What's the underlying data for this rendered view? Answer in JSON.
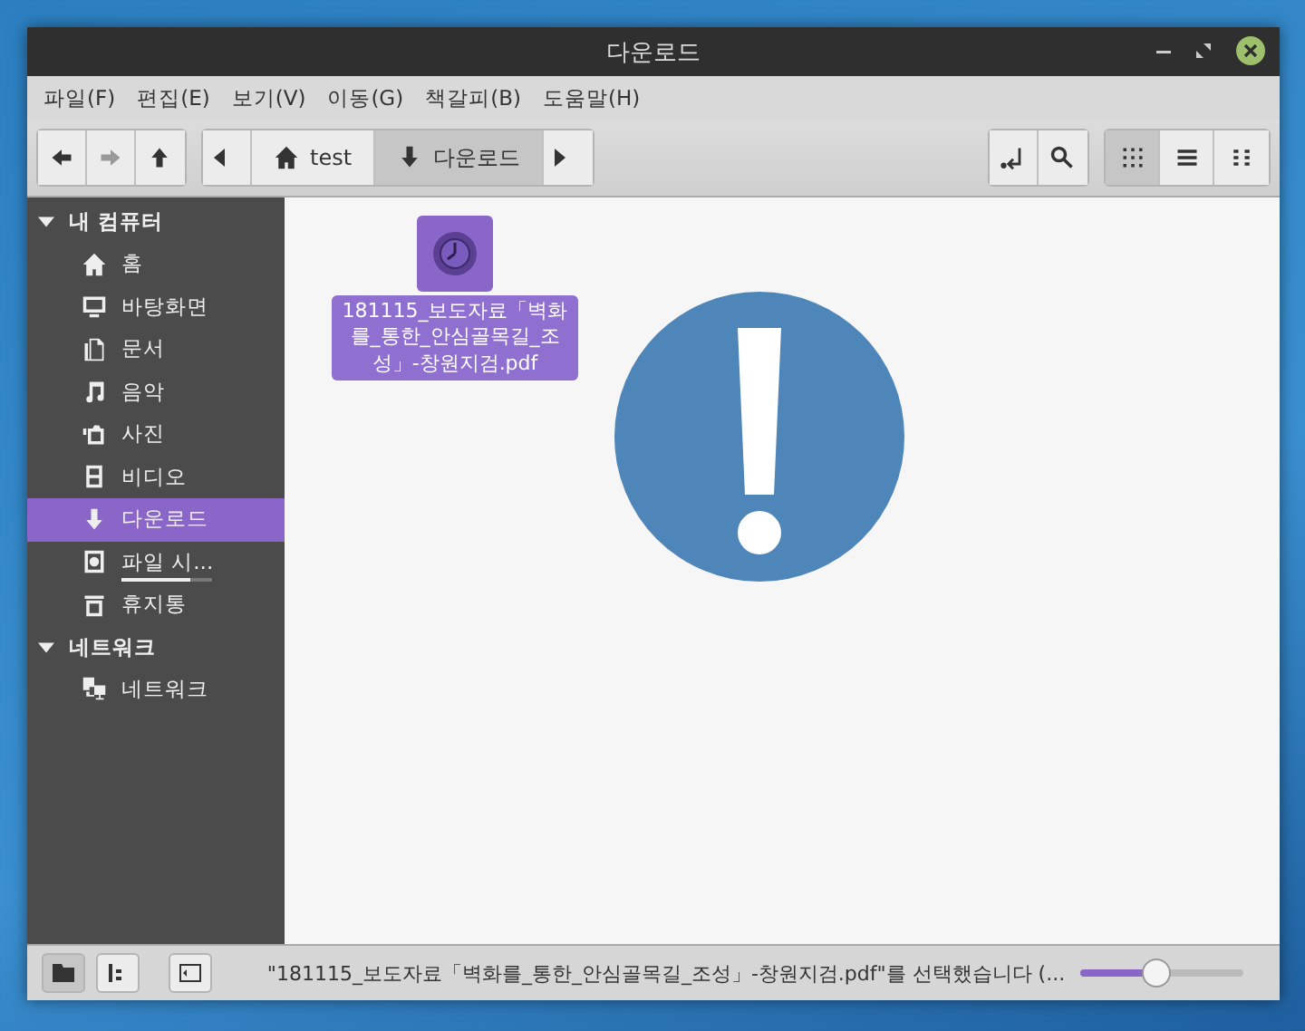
{
  "window": {
    "title": "다운로드"
  },
  "menu": [
    "파일(F)",
    "편집(E)",
    "보기(V)",
    "이동(G)",
    "책갈피(B)",
    "도움말(H)"
  ],
  "nav_buttons": [
    {
      "disabled": false
    },
    {
      "disabled": true
    },
    {
      "disabled": false
    }
  ],
  "breadcrumb": [
    {
      "label": "test",
      "selected": false
    },
    {
      "label": "다운로드",
      "selected": true
    }
  ],
  "view_buttons": [
    {
      "selected": true
    },
    {
      "selected": false
    },
    {
      "selected": false
    }
  ],
  "sidebar": [
    {
      "label": "내 컴퓨터",
      "expanded": true,
      "children": [
        {
          "label": "홈",
          "selected": false
        },
        {
          "label": "바탕화면",
          "selected": false
        },
        {
          "label": "문서",
          "selected": false
        },
        {
          "label": "음악",
          "selected": false
        },
        {
          "label": "사진",
          "selected": false
        },
        {
          "label": "비디오",
          "selected": false
        },
        {
          "label": "다운로드",
          "selected": true
        },
        {
          "label": "파일 시...",
          "selected": false,
          "level": 0.75
        },
        {
          "label": "휴지통",
          "selected": false
        }
      ]
    },
    {
      "label": "네트워크",
      "expanded": true,
      "children": [
        {
          "label": "네트워크",
          "selected": false
        }
      ]
    }
  ],
  "files": [
    {
      "name": "181115_보도자료「벽화를_통한_안심골목길_조성」-창원지검.pdf",
      "selected": true
    }
  ],
  "status_bar": {
    "text": "\"181115_보도자료「벽화를_통한_안심골목길_조성」-창원지검.pdf\"를 선택했습니다 (...",
    "zoom": {
      "level": 0.47
    }
  }
}
